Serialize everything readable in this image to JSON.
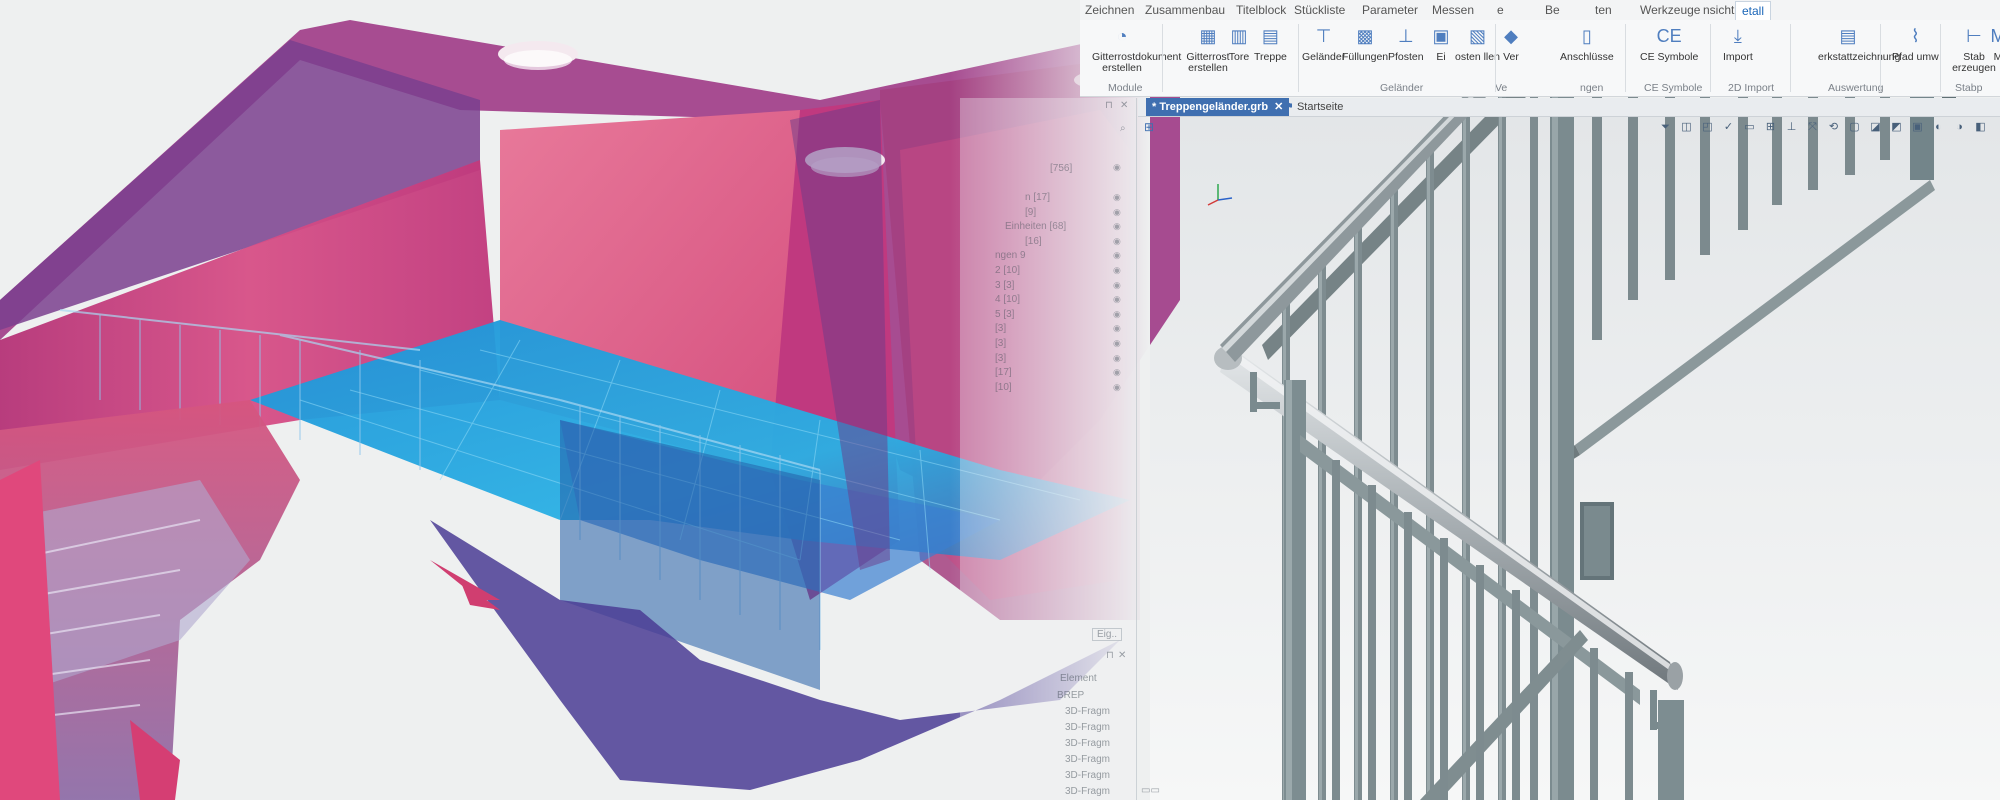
{
  "ribbon": {
    "tabs": [
      "Zeichnen",
      "Zusammenbau",
      "Titelblock",
      "Stückliste",
      "Parameter",
      "Messen",
      "e",
      "Be",
      "ten",
      "Werkzeuge",
      "nsicht",
      "etall"
    ],
    "active_tab_index": 11,
    "buttons": [
      {
        "label": "Gitterrostdokument erstellen",
        "icon": "grating-document-icon"
      },
      {
        "label": "Gitterrost erstellen",
        "icon": "grating-icon"
      },
      {
        "label": "Tore",
        "icon": "gate-icon"
      },
      {
        "label": "Treppe",
        "icon": "stair-icon"
      },
      {
        "label": "Geländer",
        "icon": "railing-icon"
      },
      {
        "label": "Füllungen",
        "icon": "infill-icon"
      },
      {
        "label": "Pfosten",
        "icon": "post-icon"
      },
      {
        "label": "Ei",
        "icon": "insert-icon"
      },
      {
        "label": "osten llen",
        "icon": "post-create-icon"
      },
      {
        "label": "Ver",
        "icon": "connect-icon"
      },
      {
        "label": "Anschlüsse",
        "icon": "connections-icon"
      },
      {
        "label": "CE Symbole",
        "icon": "ce-symbol-icon"
      },
      {
        "label": "Import",
        "icon": "import-icon"
      },
      {
        "label": "erkstattzeichnung",
        "icon": "workshop-drawing-icon"
      },
      {
        "label": "Pfad umw",
        "icon": "path-convert-icon"
      },
      {
        "label": "Stab erzeugen",
        "icon": "bar-create-icon"
      },
      {
        "label": "M",
        "icon": "more-icon"
      }
    ],
    "groups": [
      "Module",
      "Geländer",
      "Ve",
      "ngen",
      "CE Symbole",
      "2D Import",
      "Auswertung",
      "Stabp"
    ]
  },
  "document_tabs": {
    "active": "* Treppengeländer.grb",
    "close_symbol": "✕",
    "secondary": "Startseite"
  },
  "side_panel": {
    "top_count": "[756]",
    "tree_items": [
      "n [17]",
      "[9]",
      "Einheiten [68]",
      "[16]",
      "ngen 9",
      "2 [10]",
      "3 [3]",
      "4 [10]",
      "5 [3]",
      "[3]",
      "[3]",
      "[3]",
      "[17]",
      "[10]"
    ],
    "button_label": "Eig",
    "list_header": "Element",
    "list_value": "BREP",
    "list_rows": [
      "3D-Fragm",
      "3D-Fragm",
      "3D-Fragm",
      "3D-Fragm",
      "3D-Fragm",
      "3D-Fragm"
    ]
  },
  "colors": {
    "ribbon_bg": "#f7f8f9",
    "accent_blue": "#3f6fb0",
    "cloud_magenta": "#c43a7a",
    "cloud_cyan": "#2fb3e8",
    "railing_gray": "#7c8a8e",
    "handrail_steel": "#b9bec2"
  }
}
